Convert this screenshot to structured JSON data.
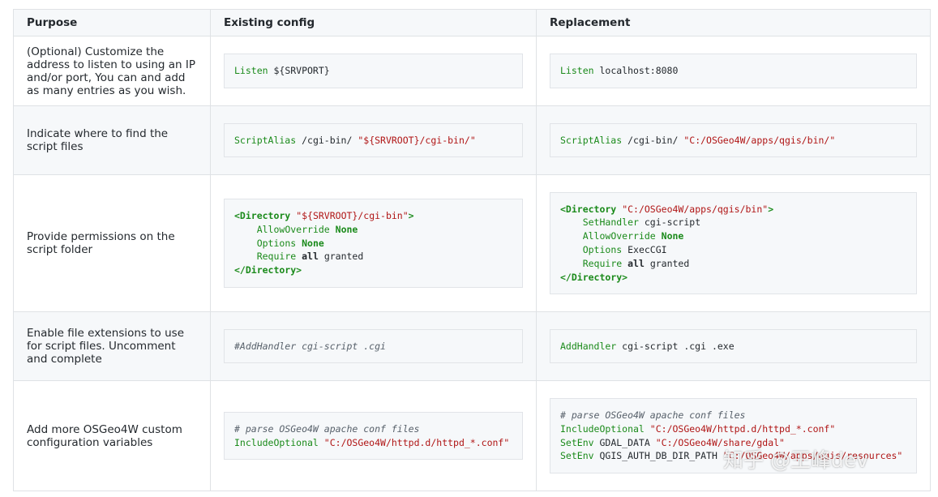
{
  "headers": [
    "Purpose",
    "Existing config",
    "Replacement"
  ],
  "rows": [
    {
      "purpose": "(Optional) Customize the address to listen to using an IP and/or port, You can and add as many entries as you wish.",
      "existing": [
        [
          "Listen ",
          "kw"
        ],
        [
          " ${SRVPORT}",
          ""
        ]
      ],
      "replacement": [
        [
          "Listen ",
          "kw"
        ],
        [
          " localhost:8080",
          ""
        ]
      ]
    },
    {
      "purpose": "Indicate where to find the script files",
      "existing_text": "ScriptAlias /cgi-bin/ \"${SRVROOT}/cgi-bin/\"",
      "replacement_text": "ScriptAlias /cgi-bin/ \"C:/OSGeo4W/apps/qgis/bin/\""
    },
    {
      "purpose": "Provide permissions on the script folder",
      "existing_text": "<Directory \"${SRVROOT}/cgi-bin\">\n    AllowOverride None\n    Options None\n    Require all granted\n</Directory>",
      "replacement_text": "<Directory \"C:/OSGeo4W/apps/qgis/bin\">\n    SetHandler cgi-script\n    AllowOverride None\n    Options ExecCGI\n    Require all granted\n</Directory>"
    },
    {
      "purpose": "Enable file extensions to use for script files. Uncomment and complete",
      "existing_text": "#AddHandler cgi-script .cgi",
      "replacement_text": "AddHandler cgi-script .cgi .exe"
    },
    {
      "purpose": "Add more OSGeo4W custom configuration variables",
      "existing_text": "# parse OSGeo4W apache conf files\nIncludeOptional \"C:/OSGeo4W/httpd.d/httpd_*.conf\"",
      "replacement_text": "# parse OSGeo4W apache conf files\nIncludeOptional \"C:/OSGeo4W/httpd.d/httpd_*.conf\"\nSetEnv GDAL_DATA \"C:/OSGeo4W/share/gdal\"\nSetEnv QGIS_AUTH_DB_DIR_PATH \"C:/OSGeo4W/apps/qgis/resources\""
    }
  ],
  "code": {
    "r0_existing": {
      "kw": "Listen",
      "rest": " ${SRVPORT}"
    },
    "r0_replacement": {
      "kw": "Listen",
      "rest": " localhost:8080"
    },
    "r1_existing": {
      "kw": "ScriptAlias",
      "mid": " /cgi-bin/ ",
      "str": "\"${SRVROOT}/cgi-bin/\""
    },
    "r1_replacement": {
      "kw": "ScriptAlias",
      "mid": " /cgi-bin/ ",
      "str": "\"C:/OSGeo4W/apps/qgis/bin/\""
    },
    "r2_existing": {
      "open_tag": "<Directory",
      "open_str": "\"${SRVROOT}/cgi-bin\"",
      "open_close": ">",
      "l1_kw": "AllowOverride",
      "l1_val": "None",
      "l2_kw": "Options",
      "l2_val": "None",
      "l3_kw": "Require",
      "l3_bold": "all",
      "l3_rest": " granted",
      "close_tag": "</Directory>"
    },
    "r2_replacement": {
      "open_tag": "<Directory",
      "open_str": "\"C:/OSGeo4W/apps/qgis/bin\"",
      "open_close": ">",
      "l0_kw": "SetHandler",
      "l0_rest": " cgi-script",
      "l1_kw": "AllowOverride",
      "l1_val": "None",
      "l2_kw": "Options",
      "l2_rest": " ExecCGI",
      "l3_kw": "Require",
      "l3_bold": "all",
      "l3_rest": " granted",
      "close_tag": "</Directory>"
    },
    "r3_existing": {
      "comment": "#AddHandler cgi-script .cgi"
    },
    "r3_replacement": {
      "kw": "AddHandler",
      "rest": " cgi-script .cgi .exe"
    },
    "r4_existing": {
      "comment": "# parse OSGeo4W apache conf files",
      "kw": "IncludeOptional",
      "str": "\"C:/OSGeo4W/httpd.d/httpd_*.conf\""
    },
    "r4_replacement": {
      "comment": "# parse OSGeo4W apache conf files",
      "l1_kw": "IncludeOptional",
      "l1_str": "\"C:/OSGeo4W/httpd.d/httpd_*.conf\"",
      "l2_kw": "SetEnv",
      "l2_mid": " GDAL_DATA ",
      "l2_str": "\"C:/OSGeo4W/share/gdal\"",
      "l3_kw": "SetEnv",
      "l3_mid": " QGIS_AUTH_DB_DIR_PATH ",
      "l3_str": "\"C:/OSGeo4W/apps/qgis/resources\""
    }
  },
  "watermark": "知乎 @王峰dev",
  "colors": {
    "keyword": "#1a8a1a",
    "string": "#b01515",
    "comment": "#57606a",
    "border": "#dfe2e5",
    "stripe": "#f6f8fa"
  }
}
